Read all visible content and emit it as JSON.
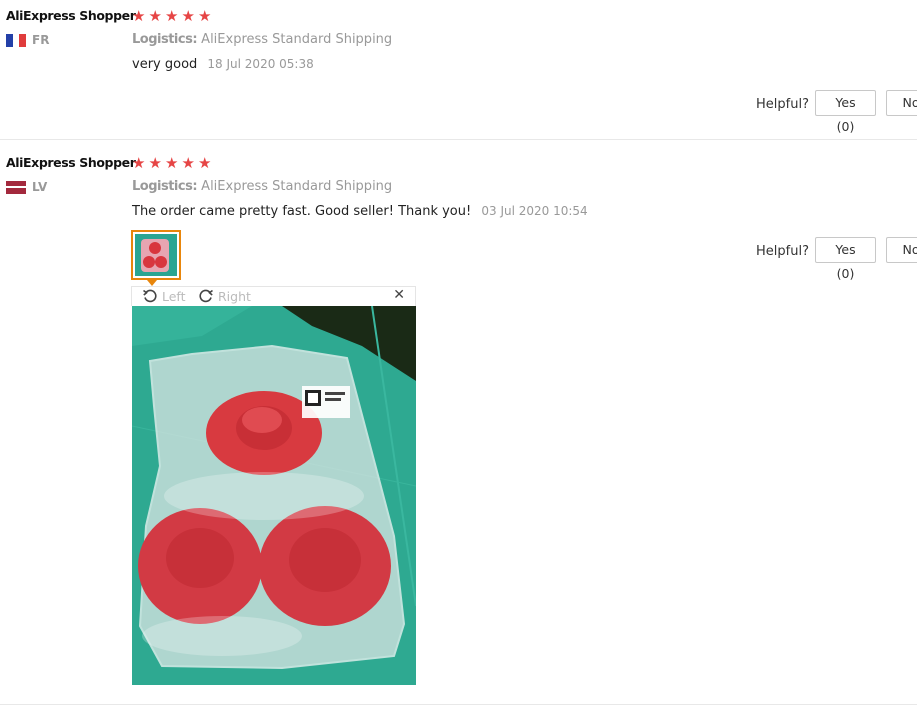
{
  "reviews": [
    {
      "user": "AliExpress Shopper",
      "country": "FR",
      "flag_colors": [
        "#2340a8",
        "#ffffff",
        "#e03c3c"
      ],
      "rating": 5,
      "logistics_label": "Logistics:",
      "logistics_value": "AliExpress Standard Shipping",
      "feedback": "very good",
      "date": "18 Jul 2020 05:38",
      "helpful_label": "Helpful?",
      "yes_label": "Yes (0)",
      "no_label": "No"
    },
    {
      "user": "AliExpress Shopper",
      "country": "LV",
      "flag_colors": [
        "#a3293d",
        "#ffffff",
        "#a3293d"
      ],
      "rating": 5,
      "logistics_label": "Logistics:",
      "logistics_value": "AliExpress Standard Shipping",
      "feedback": "The order came pretty fast. Good seller! Thank you!",
      "date": "03 Jul 2020 10:54",
      "helpful_label": "Helpful?",
      "yes_label": "Yes (0)",
      "no_label": "No",
      "viewer": {
        "rotate_left_label": "Left",
        "rotate_right_label": "Right",
        "close_symbol": "✕"
      }
    }
  ],
  "star_symbol": "★",
  "star_color": "#e64545",
  "accent_color": "#e8860c"
}
